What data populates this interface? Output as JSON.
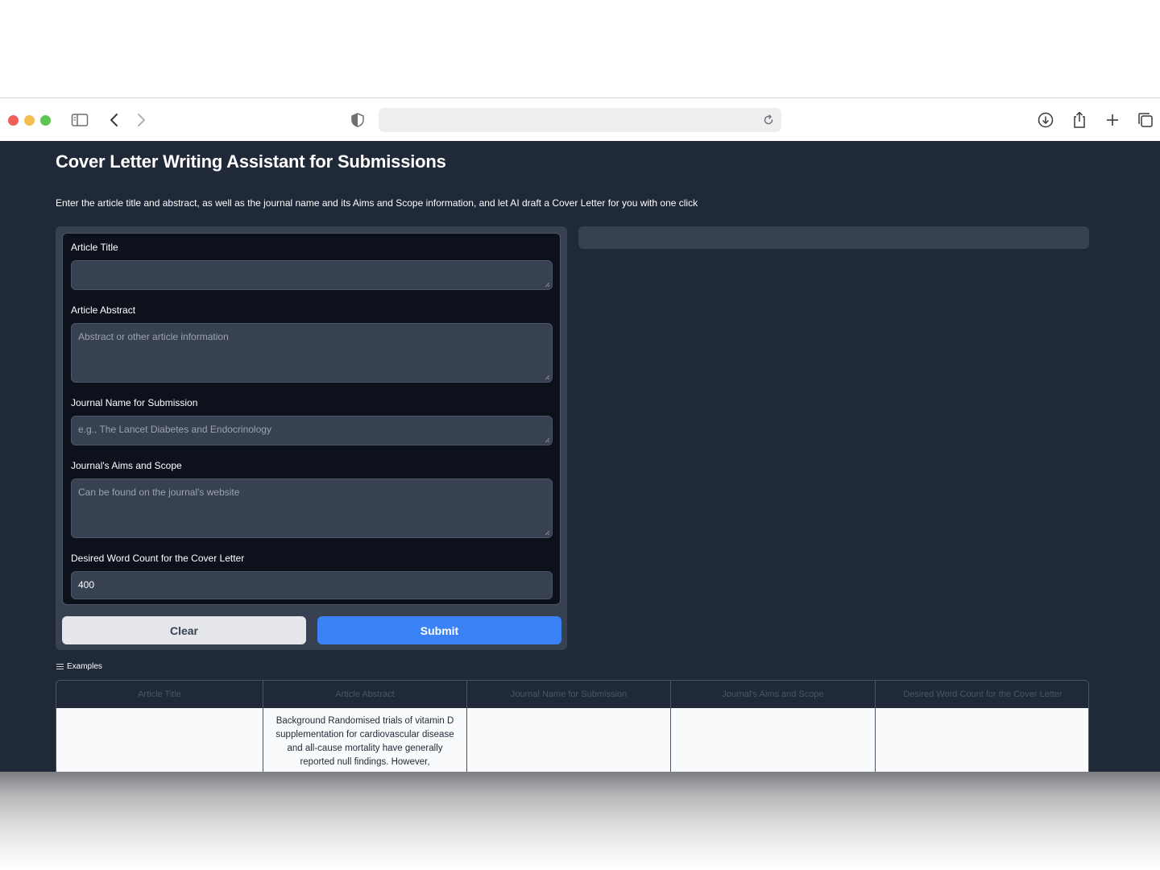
{
  "browser": {
    "icons": [
      "sidebar-icon",
      "back-icon",
      "forward-icon",
      "shield-icon",
      "reload-icon",
      "download-icon",
      "share-icon",
      "new-tab-icon",
      "tabs-overview-icon"
    ],
    "address": ""
  },
  "page": {
    "title": "Cover Letter Writing Assistant for Submissions",
    "description": "Enter the article title and abstract, as well as the journal name and its Aims and Scope information, and let AI draft a Cover Letter for you with one click"
  },
  "form": {
    "fields": [
      {
        "label": "Article Title",
        "placeholder": "",
        "value": ""
      },
      {
        "label": "Article Abstract",
        "placeholder": "Abstract or other article information",
        "value": ""
      },
      {
        "label": "Journal Name for Submission",
        "placeholder": "e.g., The Lancet Diabetes and Endocrinology",
        "value": ""
      },
      {
        "label": "Journal's Aims and Scope",
        "placeholder": "Can be found on the journal's website",
        "value": ""
      },
      {
        "label": "Desired Word Count for the Cover Letter",
        "placeholder": "",
        "value": "400"
      }
    ],
    "clear_label": "Clear",
    "submit_label": "Submit"
  },
  "output": {
    "value": ""
  },
  "examples": {
    "label": "Examples",
    "headers": [
      "Article Title",
      "Article Abstract",
      "Journal Name for Submission",
      "Journal's Aims and Scope",
      "Desired Word Count for the Cover Letter"
    ],
    "rows": [
      [
        "",
        "Background Randomised trials of vitamin D supplementation for cardiovascular disease and all-cause mortality have generally reported null findings. However,",
        "",
        "",
        ""
      ]
    ]
  },
  "colors": {
    "page_bg": "#202938",
    "panel_bg": "#374151",
    "input_bg": "#374151",
    "form_block_bg": "#0c111c",
    "submit_bg": "#3b82f6",
    "clear_bg": "#e5e7eb"
  }
}
